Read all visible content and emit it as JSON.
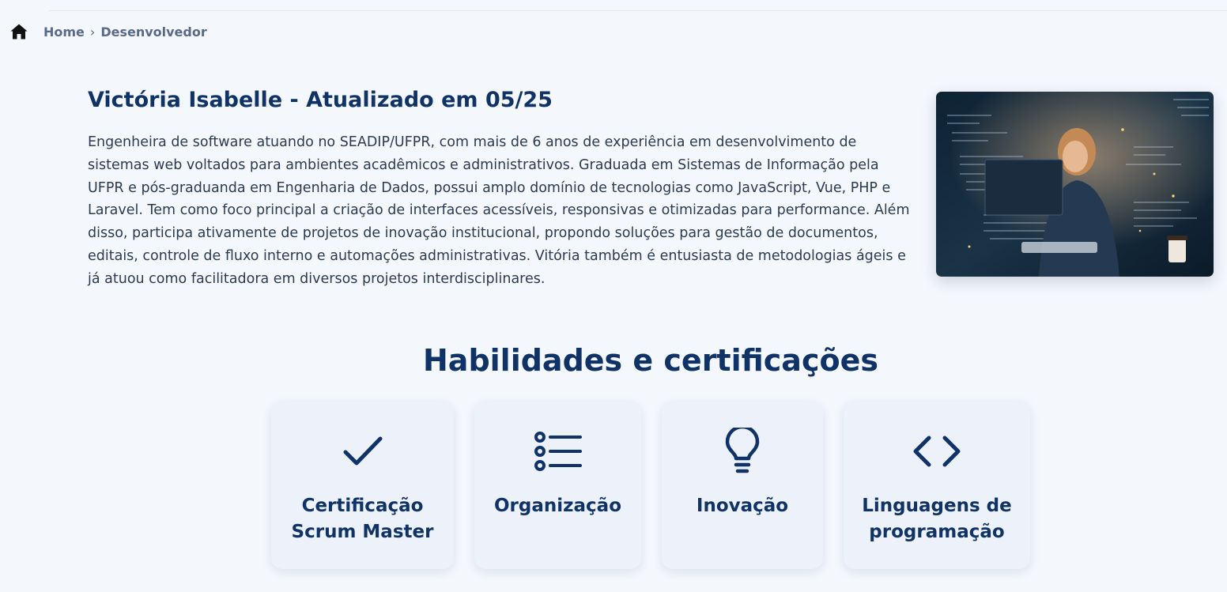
{
  "breadcrumb": {
    "home_icon": "home-icon",
    "home": "Home",
    "separator": "›",
    "current": "Desenvolvedor"
  },
  "profile": {
    "title": "Victória Isabelle - Atualizado em 05/25",
    "description": "Engenheira de software atuando no SEADIP/UFPR, com mais de 6 anos de experiência em desenvolvimento de sistemas web voltados para ambientes acadêmicos e administrativos. Graduada em Sistemas de Informação pela UFPR e pós-graduanda em Engenharia de Dados, possui amplo domínio de tecnologias como JavaScript, Vue, PHP e Laravel. Tem como foco principal a criação de interfaces acessíveis, responsivas e otimizadas para performance. Além disso, participa ativamente de projetos de inovação institucional, propondo soluções para gestão de documentos, editais, controle de fluxo interno e automações administrativas. Vitória também é entusiasta de metodologias ágeis e já atuou como facilitadora em diversos projetos interdisciplinares.",
    "image_icon": "developer-photo"
  },
  "skills": {
    "heading": "Habilidades e certificações",
    "cards": [
      {
        "icon": "checkmark-icon",
        "label": "Certificação Scrum Master"
      },
      {
        "icon": "list-icon",
        "label": "Organização"
      },
      {
        "icon": "lightbulb-icon",
        "label": "Inovação"
      },
      {
        "icon": "code-icon",
        "label": "Linguagens de programação"
      }
    ]
  },
  "colors": {
    "primary": "#0f3366",
    "background": "#f4f7fc",
    "card": "#edf1fa",
    "breadcrumb": "#58698a"
  }
}
